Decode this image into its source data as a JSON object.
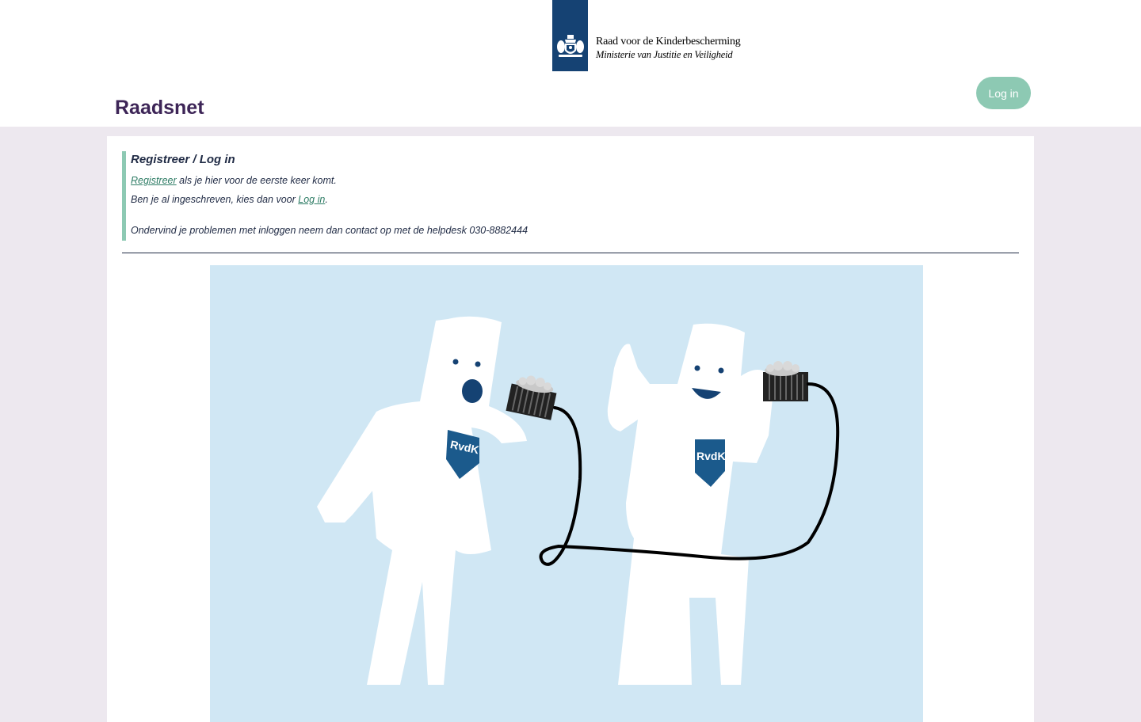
{
  "header": {
    "logo": {
      "org_name": "Raad voor de Kinderbescherming",
      "ministry": "Ministerie van Justitie en Veiligheid"
    },
    "site_title": "Raadsnet",
    "login_button": "Log in"
  },
  "notice": {
    "title": "Registreer / Log in",
    "register_link": "Registreer",
    "register_text": " als je hier voor de eerste keer komt.",
    "login_prefix": "Ben je al ingeschreven, kies dan voor ",
    "login_link": "Log in",
    "login_suffix": ".",
    "helpdesk": "Ondervind je problemen met inloggen neem dan contact op met de helpdesk 030-8882444"
  },
  "illustration": {
    "badge_left": "RvdK",
    "badge_right": "RvdK"
  },
  "colors": {
    "page_background": "#ede8ef",
    "brand_purple": "#3d2557",
    "accent_green": "#8dc9b3",
    "link_green": "#2e7c65",
    "logo_blue": "#154273",
    "illustration_bg": "#d0e7f4"
  }
}
